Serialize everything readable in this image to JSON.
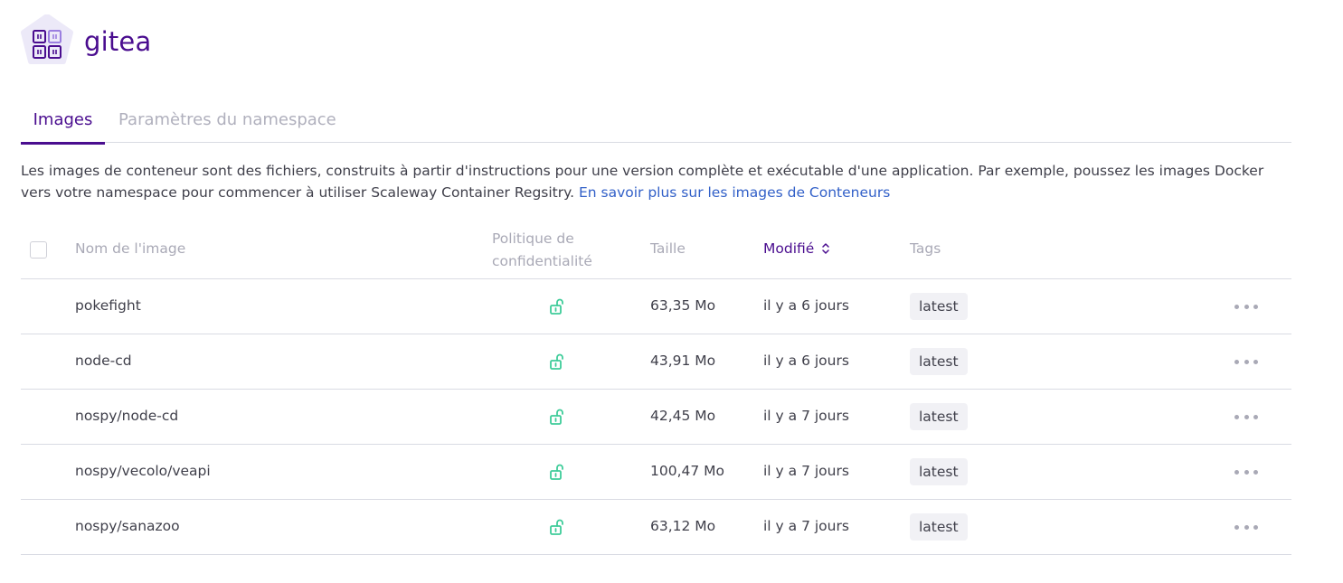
{
  "namespace": {
    "title": "gitea",
    "icon": "registry-namespace-icon",
    "accent_color": "#4a0d8f"
  },
  "tabs": [
    {
      "label": "Images",
      "active": true
    },
    {
      "label": "Paramètres du namespace",
      "active": false
    }
  ],
  "description": {
    "text": "Les images de conteneur sont des fichiers, construits à partir d'instructions pour une version complète et exécutable d'une application. Par exemple, poussez les images Docker vers votre namespace pour commencer à utiliser Scaleway Container Regsitry.",
    "link_label": "En savoir plus sur les images de Conteneurs",
    "link_color": "#3260c8"
  },
  "table": {
    "headers": {
      "name": "Nom de l'image",
      "policy_line1": "Politique de",
      "policy_line2": "confidentialité",
      "size": "Taille",
      "modified": "Modifié",
      "tags": "Tags"
    },
    "rows": [
      {
        "name": "pokefight",
        "privacy": "public",
        "size": "63,35 Mo",
        "modified": "il y a 6 jours",
        "tag": "latest"
      },
      {
        "name": "node-cd",
        "privacy": "public",
        "size": "43,91 Mo",
        "modified": "il y a 6 jours",
        "tag": "latest"
      },
      {
        "name": "nospy/node-cd",
        "privacy": "public",
        "size": "42,45 Mo",
        "modified": "il y a 7 jours",
        "tag": "latest"
      },
      {
        "name": "nospy/vecolo/veapi",
        "privacy": "public",
        "size": "100,47 Mo",
        "modified": "il y a 7 jours",
        "tag": "latest"
      },
      {
        "name": "nospy/sanazoo",
        "privacy": "public",
        "size": "63,12 Mo",
        "modified": "il y a 7 jours",
        "tag": "latest"
      }
    ],
    "lock_color": "#3ecc99"
  }
}
